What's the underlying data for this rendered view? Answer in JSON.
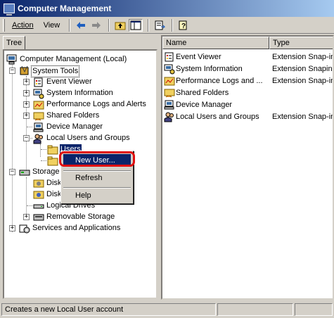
{
  "window": {
    "title": "Computer Management"
  },
  "menu": {
    "action": "Action",
    "view": "View"
  },
  "tabs": {
    "tree": "Tree"
  },
  "tree": {
    "root": "Computer Management (Local)",
    "system_tools": "System Tools",
    "event_viewer": "Event Viewer",
    "system_information": "System Information",
    "perf_logs": "Performance Logs and Alerts",
    "shared_folders": "Shared Folders",
    "device_manager": "Device Manager",
    "local_users": "Local Users and Groups",
    "users": "Users",
    "storage": "Storage",
    "disk1": "Disk",
    "disk2": "Disk",
    "logical_drives": "Logical Drives",
    "removable_storage": "Removable Storage",
    "services": "Services and Applications"
  },
  "context_menu": {
    "new_user": "New User...",
    "refresh": "Refresh",
    "help": "Help"
  },
  "list": {
    "columns": {
      "name": "Name",
      "type": "Type"
    },
    "rows": [
      {
        "name": "Event Viewer",
        "type": "Extension Snap-in",
        "icon": "event-viewer-icon"
      },
      {
        "name": "System Information",
        "type": "Extension Snapin",
        "icon": "system-information-icon"
      },
      {
        "name": "Performance Logs and ...",
        "type": "Extension Snap-in",
        "icon": "performance-icon"
      },
      {
        "name": "Shared Folders",
        "type": "",
        "icon": "shared-folders-icon"
      },
      {
        "name": "Device Manager",
        "type": "",
        "icon": "device-manager-icon"
      },
      {
        "name": "Local Users and Groups",
        "type": "Extension Snap-in",
        "icon": "users-icon"
      }
    ]
  },
  "status": {
    "text": "Creates a new Local User account"
  },
  "colors": {
    "title_start": "#0a246a",
    "title_end": "#a6caf0",
    "highlight": "#0a246a",
    "callout": "#e01010"
  }
}
